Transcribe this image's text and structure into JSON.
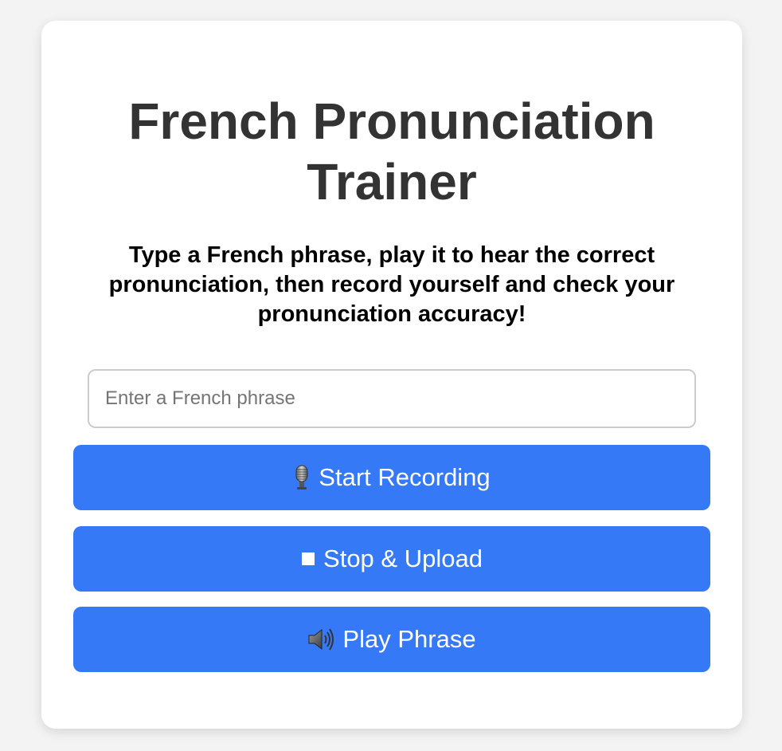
{
  "header": {
    "title": "French Pronunciation Trainer",
    "instructions": "Type a French phrase, play it to hear the correct pronunciation, then record yourself and check your pronunciation accuracy!"
  },
  "phrase_input": {
    "value": "",
    "placeholder": "Enter a French phrase"
  },
  "buttons": {
    "start_recording": {
      "icon": "microphone-icon",
      "label": "Start Recording"
    },
    "stop_upload": {
      "icon": "stop-square-icon",
      "label": "Stop & Upload"
    },
    "play_phrase": {
      "icon": "speaker-icon",
      "label": "Play Phrase"
    }
  },
  "colors": {
    "page_background": "#f3f3f3",
    "card_background": "#ffffff",
    "button_primary": "#3579f6",
    "title_text": "#333333"
  }
}
